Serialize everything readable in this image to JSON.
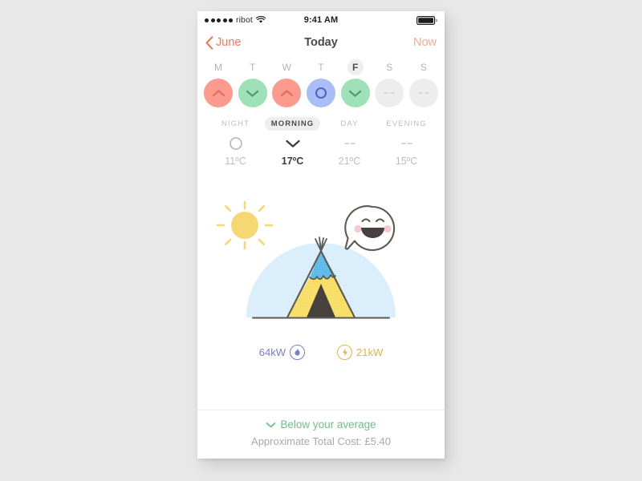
{
  "status_bar": {
    "signal_dots": 5,
    "carrier": "ribot",
    "wifi_icon": "wifi-icon",
    "time": "9:41 AM",
    "battery_icon": "battery-full-icon"
  },
  "nav": {
    "back_icon": "chevron-left-icon",
    "back_label": "June",
    "title": "Today",
    "now_label": "Now",
    "accent_color": "#f0785a",
    "now_color": "#f7a894"
  },
  "week": {
    "days": [
      {
        "letter": "M",
        "state": "up",
        "icon": "chevron-up-icon",
        "color": "#fb9a8d",
        "active": false
      },
      {
        "letter": "T",
        "state": "down",
        "icon": "chevron-down-icon",
        "color": "#9ee0b8",
        "active": false
      },
      {
        "letter": "W",
        "state": "up",
        "icon": "chevron-up-icon",
        "color": "#fb9a8d",
        "active": false
      },
      {
        "letter": "T",
        "state": "ring",
        "icon": "circle-ring-icon",
        "color": "#a9bdf7",
        "active": false
      },
      {
        "letter": "F",
        "state": "down",
        "icon": "chevron-down-icon",
        "color": "#9ee0b8",
        "active": true
      },
      {
        "letter": "S",
        "state": "none",
        "icon": "dashes-icon",
        "color": "#ededed",
        "active": false
      },
      {
        "letter": "S",
        "state": "none",
        "icon": "dashes-icon",
        "color": "#ededed",
        "active": false
      }
    ]
  },
  "periods": [
    {
      "label": "NIGHT",
      "icon": "circle-ring-icon",
      "temp": "11ºC",
      "active": false
    },
    {
      "label": "MORNING",
      "icon": "chevron-down-icon",
      "temp": "17ºC",
      "active": true
    },
    {
      "label": "DAY",
      "icon": "dashes-icon",
      "temp": "21ºC",
      "active": false
    },
    {
      "label": "EVENING",
      "icon": "dashes-icon",
      "temp": "15ºC",
      "active": false
    }
  ],
  "illustration": {
    "sun_icon": "sun-icon",
    "face_icon": "happy-face-speech-bubble-icon",
    "tent_icon": "tent-icon",
    "sun_color": "#f5d濃"
  },
  "energy": {
    "gas": {
      "value": "64kW",
      "icon": "flame-icon",
      "color": "#7b7fc4"
    },
    "electric": {
      "value": "21kW",
      "icon": "lightning-bolt-icon",
      "color": "#e0b44e"
    }
  },
  "footer": {
    "average_icon": "chevron-down-icon",
    "average_label": "Below your average",
    "average_color": "#6fbf8b",
    "cost_label": "Approximate Total Cost: £5.40"
  }
}
